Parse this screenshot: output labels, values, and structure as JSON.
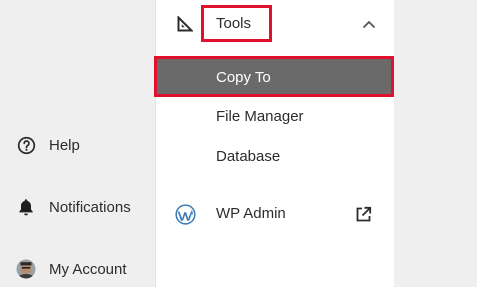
{
  "left_nav": {
    "help_label": "Help",
    "notifications_label": "Notifications",
    "account_label": "My Account"
  },
  "menu": {
    "tools_label": "Tools",
    "items": [
      {
        "label": "Copy To"
      },
      {
        "label": "File Manager"
      },
      {
        "label": "Database"
      }
    ],
    "wp_admin_label": "WP Admin"
  },
  "colors": {
    "highlight_border": "#e0102e",
    "selected_bg": "#6a6a6a",
    "wp_blue": "#3a7ab8"
  }
}
